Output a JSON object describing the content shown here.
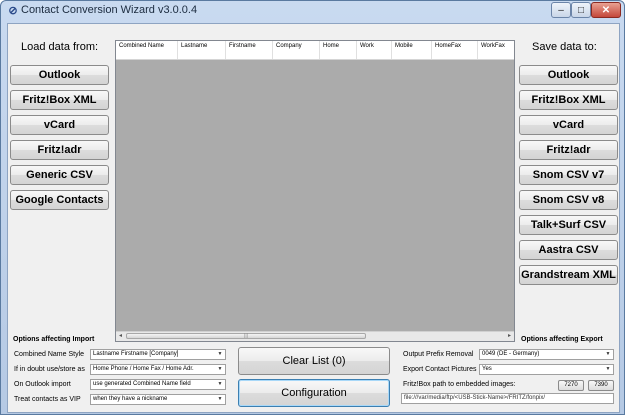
{
  "window": {
    "title": "Contact Conversion Wizard v3.0.0.4",
    "app_icon": "⊘",
    "minimize": "–",
    "maximize": "□",
    "close": "✕"
  },
  "load": {
    "title": "Load data from:",
    "buttons": [
      "Outlook",
      "Fritz!Box XML",
      "vCard",
      "Fritz!adr",
      "Generic CSV",
      "Google Contacts"
    ]
  },
  "save": {
    "title": "Save data to:",
    "buttons": [
      "Outlook",
      "Fritz!Box XML",
      "vCard",
      "Fritz!adr",
      "Snom CSV v7",
      "Snom CSV v8",
      "Talk+Surf CSV",
      "Aastra CSV",
      "Grandstream XML"
    ]
  },
  "grid": {
    "columns": [
      "Combined Name",
      "Lastname",
      "Firstname",
      "Company",
      "Home",
      "Work",
      "Mobile",
      "HomeFax",
      "WorkFax"
    ],
    "scroll_left": "◂",
    "scroll_right": "▸",
    "thumb_grip": "|||"
  },
  "import_options": {
    "title": "Options affecting Import",
    "rows": [
      {
        "label": "Combined Name Style",
        "value": "Lastname Firstname [Company]"
      },
      {
        "label": "If in doubt use/store as",
        "value": "Home Phone / Home Fax / Home Adr."
      },
      {
        "label": "On Outlook import",
        "value": "use generated Combined Name field"
      },
      {
        "label": "Treat contacts as VIP",
        "value": "when they have a nickname"
      }
    ]
  },
  "actions": {
    "clear_list": "Clear List (0)",
    "configuration": "Configuration"
  },
  "export_options": {
    "title": "Options affecting Export",
    "rows": [
      {
        "label": "Output Prefix Removal",
        "value": "0049 (DE - Germany)"
      },
      {
        "label": "Export Contact Pictures",
        "value": "Yes"
      }
    ],
    "path_label": "Fritz!Box path to embedded images:",
    "port_buttons": [
      "7270",
      "7390"
    ],
    "path_value": "file:///var/media/ftp/<USB-Stick-Name>/FRITZ/fonpix/"
  },
  "combo_arrow": "▼"
}
